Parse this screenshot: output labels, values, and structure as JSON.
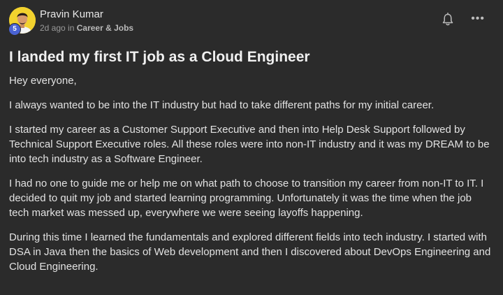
{
  "post": {
    "author": "Pravin Kumar",
    "level": "5",
    "time_ago": "2d ago",
    "in_word": "in",
    "category": "Career & Jobs",
    "title": "I landed my first IT job as a Cloud Engineer",
    "more_label": "•••",
    "paragraphs": [
      "Hey everyone,",
      "I always wanted to be into the IT industry but had to take different paths for my initial career.",
      "I started my career as a Customer Support Executive and then into Help Desk Support followed by Technical Support Executive roles. All these roles were into non-IT industry and it was my DREAM to be into tech industry as a Software Engineer.",
      "I had no one to guide me or help me on what path to choose to transition my career from non-IT to IT. I decided to quit my job and started learning programming. Unfortunately it was the time when the job tech market was messed up, everywhere we were seeing layoffs happening.",
      "During this time I learned the fundamentals and explored different fields into tech industry. I started with DSA in Java then the basics of Web development and then I discovered about DevOps Engineering and Cloud Engineering."
    ]
  },
  "icons": {
    "bell": "bell-icon",
    "more": "more-options-icon"
  },
  "colors": {
    "background": "#2b2b2b",
    "avatar_bg": "#f2d22e",
    "badge": "#4a63d3",
    "text": "#e2e2e2",
    "muted": "#9a9a9a"
  }
}
